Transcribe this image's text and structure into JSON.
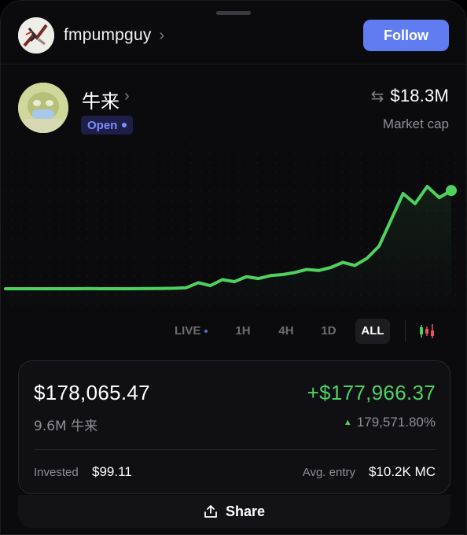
{
  "creator": {
    "name": "fmpumpguy",
    "follow_label": "Follow",
    "icon": "chevron-right-icon"
  },
  "token": {
    "name": "牛来",
    "status": "Open",
    "market_cap": "$18.3M",
    "market_cap_label": "Market cap"
  },
  "chart_data": {
    "type": "line",
    "color": "#4fd160",
    "values": [
      1.0,
      1.0,
      1.0,
      1.0,
      1.0,
      1.0,
      1.0,
      1.02,
      1.0,
      1.0,
      1.0,
      1.01,
      1.02,
      1.03,
      1.05,
      1.1,
      1.6,
      1.3,
      1.9,
      1.7,
      2.2,
      2.0,
      2.3,
      2.4,
      2.6,
      2.9,
      2.8,
      3.1,
      3.6,
      3.3,
      4.0,
      5.2,
      7.8,
      10.4,
      9.4,
      11.1,
      10.0,
      10.7
    ]
  },
  "timeframes": {
    "live": "LIVE",
    "h1": "1H",
    "h4": "4H",
    "d1": "1D",
    "all": "ALL",
    "selected": "ALL"
  },
  "position": {
    "value": "$178,065.47",
    "gain": "+$177,966.37",
    "quantity": "9.6M 牛来",
    "gain_pct": "179,571.80%",
    "invested_label": "Invested",
    "invested_value": "$99.11",
    "avg_entry_label": "Avg. entry",
    "avg_entry_value": "$10.2K MC"
  },
  "share_label": "Share",
  "colors": {
    "accent": "#5f7cf0",
    "positive": "#4fd160",
    "badge": "#7c8cff"
  }
}
